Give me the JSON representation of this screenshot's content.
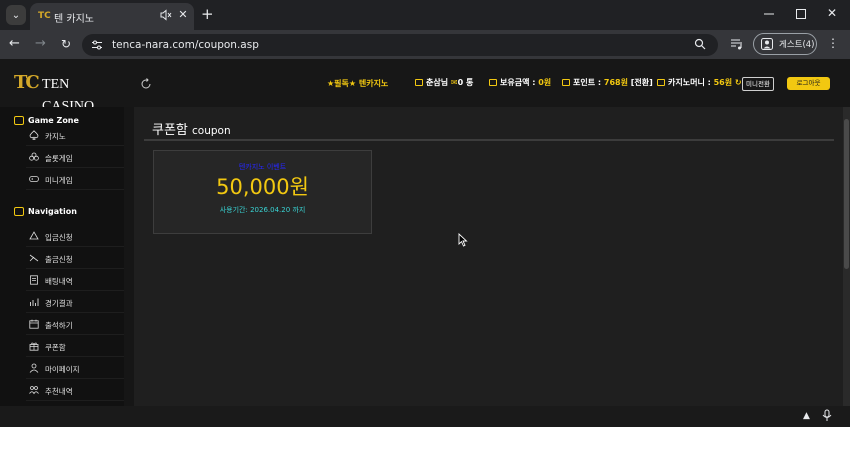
{
  "browser": {
    "tab_title": "텐 카지노",
    "tab_favicon": "TC",
    "url": "tenca-nara.com/coupon.asp",
    "profile_label": "게스트(4)",
    "icons": [
      "tab-list-icon",
      "speaker-muted-icon",
      "close-icon",
      "new-tab-icon",
      "minimize-icon",
      "maximize-icon",
      "back-arrow-icon",
      "forward-arrow-icon",
      "reload-icon",
      "site-info-icon",
      "zoom-icon",
      "media-controls-icon",
      "profile-icon",
      "more-menu-icon"
    ]
  },
  "site": {
    "logo_mark": "TC",
    "logo_first": "T",
    "logo_text_1": "EN",
    "logo_second": "C",
    "logo_text_2": "ASINO",
    "marquee": "★필독★ 텐카지노",
    "user_name": "춘삼님",
    "user_count": "0 통",
    "balance_label": "보유금액 :",
    "balance_value": "0원",
    "points_label": "포인트 :",
    "points_value": "768원",
    "points_convert": "[전환]",
    "casino_money_label": "카지노머니 :",
    "casino_money_value": "56원",
    "mini_button": "미니전환",
    "logout_button": "로그아웃"
  },
  "sidebar": {
    "game_zone_title": "Game Zone",
    "game_zone_items": [
      {
        "label": "카지노",
        "icon": "spade-icon"
      },
      {
        "label": "슬롯게임",
        "icon": "club-icon"
      },
      {
        "label": "미니게임",
        "icon": "gamepad-icon"
      }
    ],
    "navigation_title": "Navigation",
    "navigation_items": [
      {
        "label": "입금신청",
        "icon": "deposit-icon"
      },
      {
        "label": "출금신청",
        "icon": "withdraw-icon"
      },
      {
        "label": "배팅내역",
        "icon": "betting-history-icon"
      },
      {
        "label": "경기결과",
        "icon": "results-icon"
      },
      {
        "label": "출석하기",
        "icon": "calendar-icon"
      },
      {
        "label": "쿠폰함",
        "icon": "gift-icon"
      },
      {
        "label": "마이페이지",
        "icon": "user-icon"
      },
      {
        "label": "추천내역",
        "icon": "referral-icon"
      }
    ]
  },
  "content": {
    "title": "쿠폰함",
    "title_sub": "coupon",
    "coupon": {
      "label": "텐카지노 이벤트",
      "amount": "50,000원",
      "expiry": "사용기간: 2026.04.20 까지"
    }
  },
  "colors": {
    "accent_gold": "#f2c811",
    "coupon_label": "#2626ff",
    "expiry_cyan": "#39d3d3",
    "page_bg": "#1f1f1f"
  }
}
